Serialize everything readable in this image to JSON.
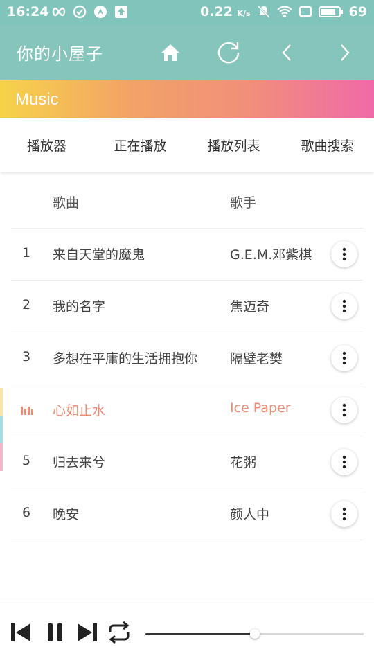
{
  "status_bar": {
    "time": "16:24",
    "speed": "0.22",
    "speed_unit": "K/s",
    "battery": "69",
    "icons_left": [
      "infinity-icon",
      "check-circle-icon",
      "navigation-icon",
      "upload-icon"
    ],
    "icons_right": [
      "mute-icon",
      "wifi-icon",
      "screen-icon",
      "battery-icon"
    ]
  },
  "header": {
    "title": "你的小屋子",
    "icons": [
      "home-icon",
      "refresh-icon",
      "back-icon",
      "forward-icon"
    ]
  },
  "music_label": "Music",
  "tabs": [
    {
      "label": "播放器"
    },
    {
      "label": "正在播放"
    },
    {
      "label": "播放列表"
    },
    {
      "label": "歌曲搜索"
    }
  ],
  "list": {
    "columns": {
      "song": "歌曲",
      "artist": "歌手"
    },
    "rows": [
      {
        "num": "1",
        "song": "来自天堂的魔鬼",
        "artist": "G.E.M.邓紫棋",
        "playing": false
      },
      {
        "num": "2",
        "song": "我的名字",
        "artist": "焦迈奇",
        "playing": false
      },
      {
        "num": "3",
        "song": "多想在平庸的生活拥抱你",
        "artist": "隔壁老樊",
        "playing": false
      },
      {
        "num": "",
        "song": "心如止水",
        "artist": "Ice Paper",
        "playing": true
      },
      {
        "num": "5",
        "song": "归去来兮",
        "artist": "花粥",
        "playing": false
      },
      {
        "num": "6",
        "song": "晚安",
        "artist": "颜人中",
        "playing": false
      }
    ]
  },
  "player": {
    "progress": 0.5,
    "controls": [
      "previous-icon",
      "pause-icon",
      "next-icon",
      "repeat-icon"
    ]
  },
  "colors": {
    "header": "#85c5bb",
    "accent": "#f08a73",
    "gradient": [
      "#f6d34a",
      "#f3a267",
      "#f06aa9"
    ],
    "side_strip": [
      "#f9e4a8",
      "#a6dde1",
      "#f2b8c9"
    ]
  }
}
